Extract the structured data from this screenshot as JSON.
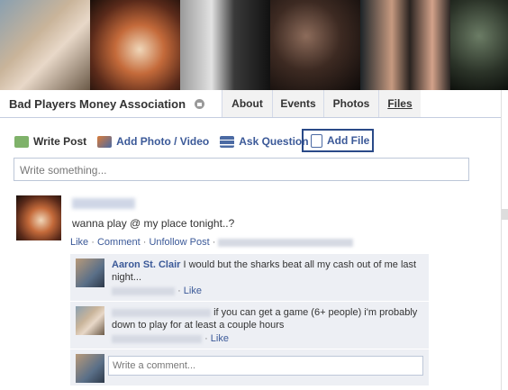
{
  "group": {
    "name": "Bad Players Money Association"
  },
  "tabs": {
    "about": "About",
    "events": "Events",
    "photos": "Photos",
    "files": "Files"
  },
  "composer": {
    "write_post": "Write Post",
    "add_photo": "Add Photo / Video",
    "ask_question": "Ask Question",
    "add_file": "Add File",
    "placeholder": "Write something..."
  },
  "post": {
    "text": "wanna play @ my place tonight..?",
    "like": "Like",
    "comment": "Comment",
    "unfollow": "Unfollow Post",
    "sep": " · "
  },
  "comments": [
    {
      "author": "Aaron St. Clair",
      "text": "I would but the sharks beat all my cash out of me last night...",
      "like": "Like"
    },
    {
      "author": "",
      "text": "if you can get a game (6+ people) i'm probably down to play for at least a couple hours",
      "like": "Like"
    }
  ],
  "comment_input": {
    "placeholder": "Write a comment..."
  }
}
